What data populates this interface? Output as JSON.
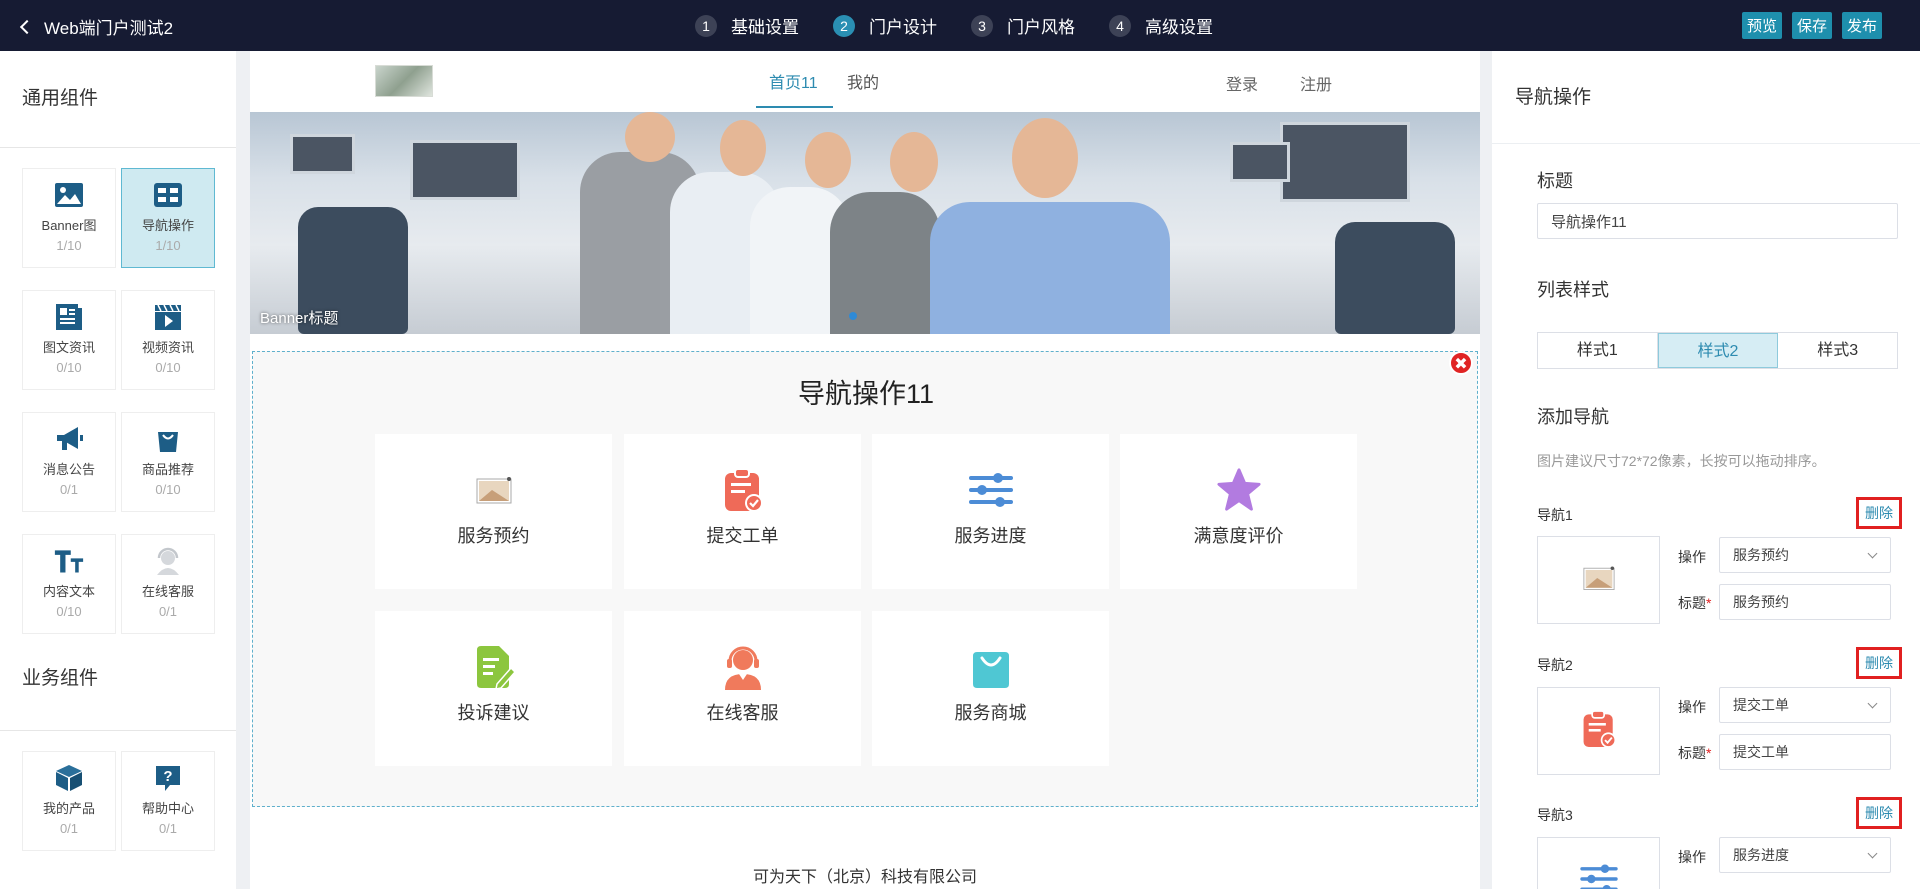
{
  "app": {
    "back_label": "Web端门户测试2"
  },
  "steps": [
    {
      "num": "1",
      "label": "基础设置"
    },
    {
      "num": "2",
      "label": "门户设计"
    },
    {
      "num": "3",
      "label": "门户风格"
    },
    {
      "num": "4",
      "label": "高级设置"
    }
  ],
  "top_actions": {
    "preview": "预览",
    "save": "保存",
    "publish": "发布"
  },
  "left_panel": {
    "general_title": "通用组件",
    "business_title": "业务组件",
    "general_components": [
      {
        "name": "Banner图",
        "count": "1/10",
        "icon": "image-icon"
      },
      {
        "name": "导航操作",
        "count": "1/10",
        "icon": "nav-grid-icon"
      },
      {
        "name": "图文资讯",
        "count": "0/10",
        "icon": "article-icon"
      },
      {
        "name": "视频资讯",
        "count": "0/10",
        "icon": "video-icon"
      },
      {
        "name": "消息公告",
        "count": "0/1",
        "icon": "megaphone-icon"
      },
      {
        "name": "商品推荐",
        "count": "0/10",
        "icon": "shopping-bag-icon"
      },
      {
        "name": "内容文本",
        "count": "0/10",
        "icon": "text-icon"
      },
      {
        "name": "在线客服",
        "count": "0/1",
        "icon": "customer-service-icon"
      }
    ],
    "business_components": [
      {
        "name": "我的产品",
        "count": "0/1",
        "icon": "cube-icon"
      },
      {
        "name": "帮助中心",
        "count": "0/1",
        "icon": "help-icon"
      }
    ]
  },
  "portal": {
    "tabs": [
      "首页11",
      "我的"
    ],
    "login": "登录",
    "register": "注册",
    "banner_title": "Banner标题",
    "nav_module_title": "导航操作11",
    "nav_cards": [
      {
        "label": "服务预约",
        "icon": "image-thumb-icon"
      },
      {
        "label": "提交工单",
        "icon": "clipboard-check-icon"
      },
      {
        "label": "服务进度",
        "icon": "sliders-icon"
      },
      {
        "label": "满意度评价",
        "icon": "star-icon"
      },
      {
        "label": "投诉建议",
        "icon": "note-edit-icon"
      },
      {
        "label": "在线客服",
        "icon": "headset-agent-icon"
      },
      {
        "label": "服务商城",
        "icon": "shopping-bag-icon"
      }
    ],
    "close_symbol": "✖",
    "footer": "可为天下（北京）科技有限公司"
  },
  "right_panel": {
    "header": "导航操作",
    "title_label": "标题",
    "title_value": "导航操作11",
    "list_style_label": "列表样式",
    "style_tabs": [
      "样式1",
      "样式2",
      "样式3"
    ],
    "add_nav_label": "添加导航",
    "hint": "图片建议尺寸72*72像素，长按可以拖动排序。",
    "delete_label": "删除",
    "op_label": "操作",
    "name_label": "标题",
    "req_mark": "*",
    "nav_items": [
      {
        "title": "导航1",
        "op": "服务预约",
        "name": "服务预约"
      },
      {
        "title": "导航2",
        "op": "提交工单",
        "name": "提交工单"
      },
      {
        "title": "导航3",
        "op": "服务进度",
        "name": ""
      }
    ]
  },
  "colors": {
    "topbar_bg": "#161b33",
    "accent": "#2d8bb0",
    "action_btn": "#1e8fad",
    "delete_highlight": "#e12020"
  }
}
